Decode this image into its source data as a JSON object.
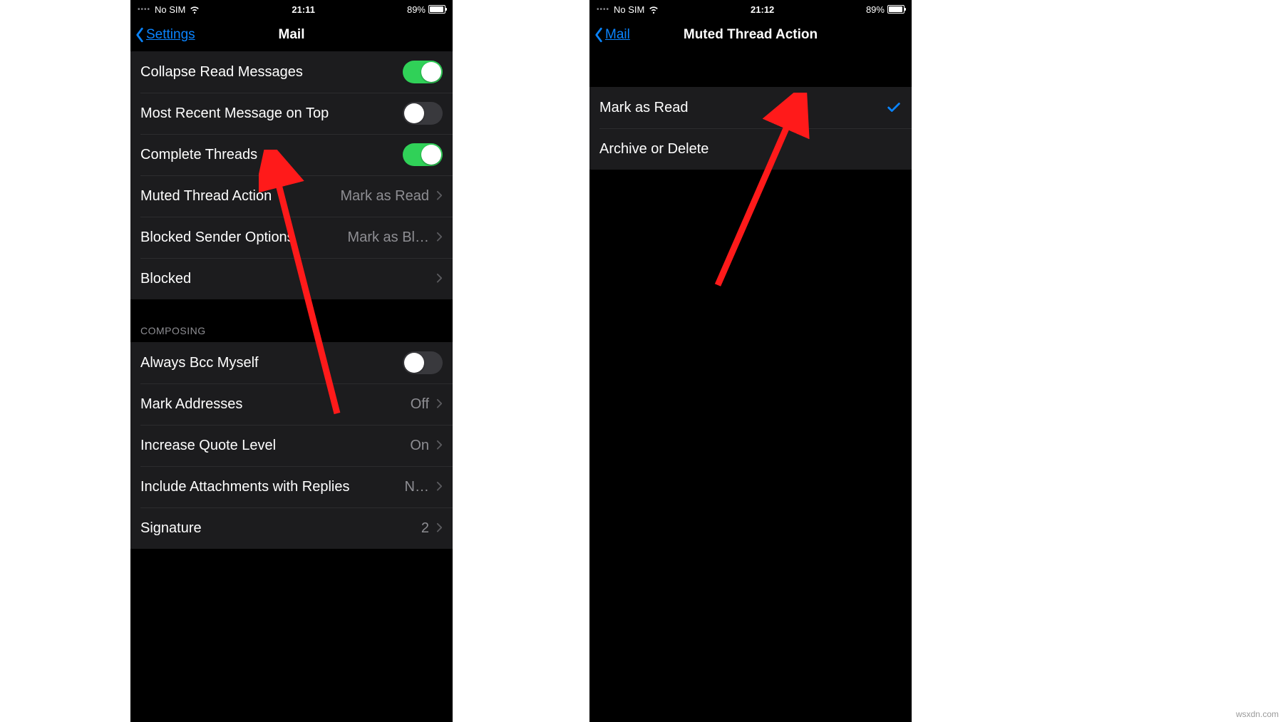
{
  "watermark": "wsxdn.com",
  "left": {
    "status": {
      "carrier": "No SIM",
      "time": "21:11",
      "battery": "89%"
    },
    "nav": {
      "back": "Settings",
      "title": "Mail"
    },
    "rows_threading": [
      {
        "label": "Collapse Read Messages",
        "type": "toggle",
        "on": true
      },
      {
        "label": "Most Recent Message on Top",
        "type": "toggle",
        "on": false
      },
      {
        "label": "Complete Threads",
        "type": "toggle",
        "on": true
      },
      {
        "label": "Muted Thread Action",
        "type": "link",
        "value": "Mark as Read"
      },
      {
        "label": "Blocked Sender Options",
        "type": "link",
        "value": "Mark as Bl…"
      },
      {
        "label": "Blocked",
        "type": "link",
        "value": ""
      }
    ],
    "section_composing": "Composing",
    "rows_composing": [
      {
        "label": "Always Bcc Myself",
        "type": "toggle",
        "on": false
      },
      {
        "label": "Mark Addresses",
        "type": "link",
        "value": "Off"
      },
      {
        "label": "Increase Quote Level",
        "type": "link",
        "value": "On"
      },
      {
        "label": "Include Attachments with Replies",
        "type": "link",
        "value": "N…"
      },
      {
        "label": "Signature",
        "type": "link",
        "value": "2"
      }
    ]
  },
  "right": {
    "status": {
      "carrier": "No SIM",
      "time": "21:12",
      "battery": "89%"
    },
    "nav": {
      "back": "Mail",
      "title": "Muted Thread Action"
    },
    "options": [
      {
        "label": "Mark as Read",
        "selected": true
      },
      {
        "label": "Archive or Delete",
        "selected": false
      }
    ]
  }
}
